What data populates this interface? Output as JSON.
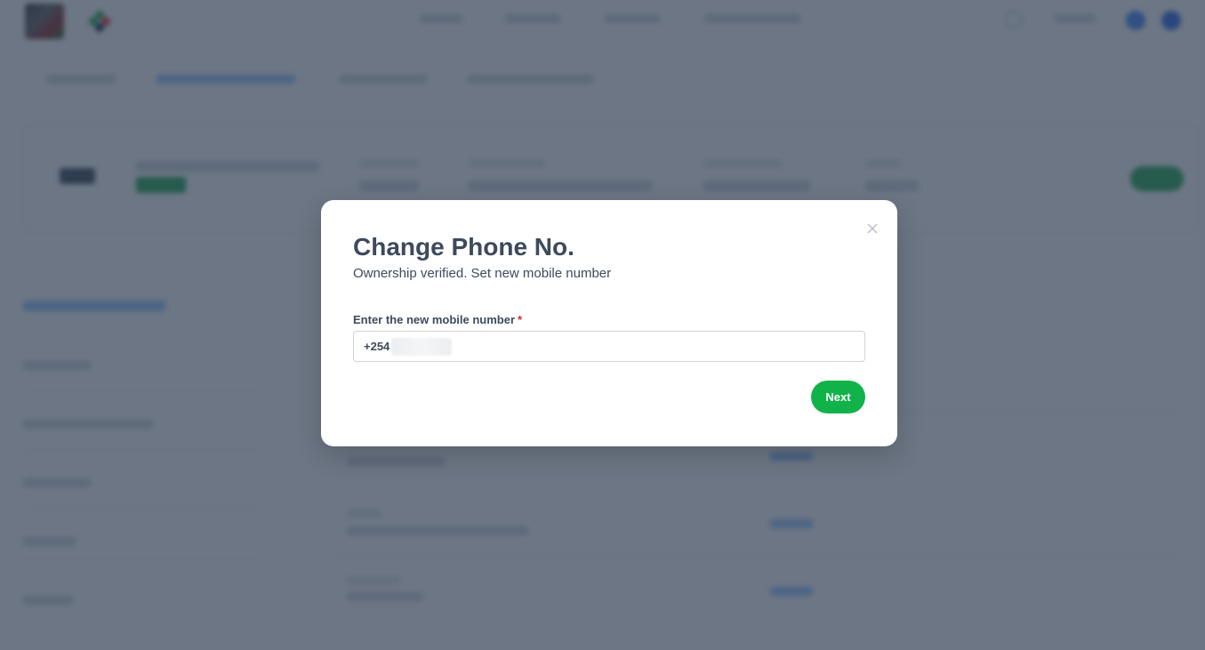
{
  "modal": {
    "title": "Change Phone No.",
    "subtitle": "Ownership verified. Set new mobile number",
    "field_label": "Enter the new mobile number",
    "required_marker": "*",
    "phone_prefix": "+254",
    "next_label": "Next"
  },
  "colors": {
    "primary_green": "#12b24a",
    "text_dark": "#3d4a5c",
    "required_red": "#dc2626",
    "overlay": "rgba(45,60,80,0.70)"
  }
}
